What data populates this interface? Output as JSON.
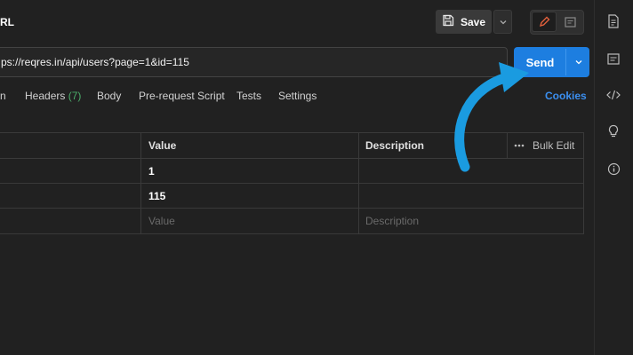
{
  "header": {
    "title": "RL",
    "save_label": "Save"
  },
  "url_bar": {
    "value": "ps://reqres.in/api/users?page=1&id=115",
    "send_label": "Send"
  },
  "tabs": [
    {
      "label": "n"
    },
    {
      "label": "Headers",
      "count": "(7)"
    },
    {
      "label": "Body"
    },
    {
      "label": "Pre-request Script"
    },
    {
      "label": "Tests"
    },
    {
      "label": "Settings"
    }
  ],
  "cookies_label": "Cookies",
  "params_table": {
    "columns": {
      "value": "Value",
      "description": "Description",
      "bulk_edit": "Bulk Edit"
    },
    "rows": [
      {
        "value": "1"
      },
      {
        "value": "115"
      }
    ],
    "placeholders": {
      "value": "Value",
      "description": "Description"
    }
  },
  "colors": {
    "accent": "#1d7ee0",
    "arrow": "#1a9be0",
    "count_green": "#4cae6a",
    "link": "#3b8ff0"
  },
  "icons": [
    "save-icon",
    "chevron-down-icon",
    "pencil-icon",
    "comment-icon",
    "document-icon",
    "code-icon",
    "bulb-icon",
    "info-icon",
    "more-icon"
  ]
}
